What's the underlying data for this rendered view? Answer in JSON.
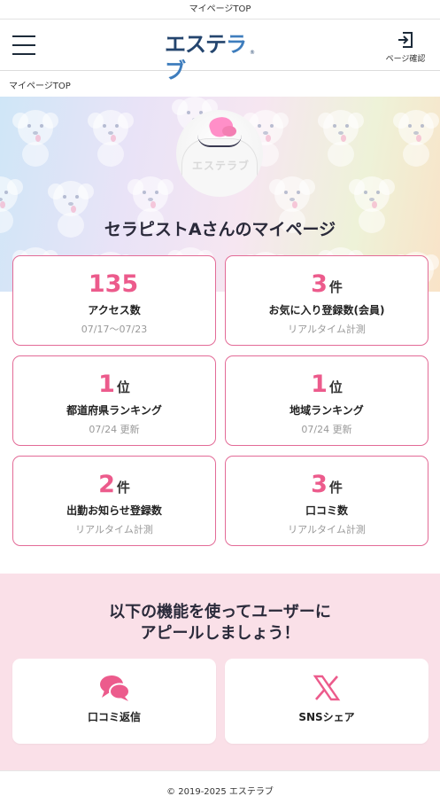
{
  "top_bar": {
    "title": "マイページTOP"
  },
  "header": {
    "logo": "エステラブ",
    "logo_reg": "®",
    "page_confirm_label": "ページ確認"
  },
  "breadcrumb": "マイページTOP",
  "hero": {
    "title": "セラピストAさんのマイページ",
    "avatar_watermark": "エステラブ"
  },
  "stats": [
    {
      "value": "135",
      "unit": "",
      "title": "アクセス数",
      "sub": "07/17〜07/23"
    },
    {
      "value": "3",
      "unit": "件",
      "title": "お気に入り登録数(会員)",
      "sub": "リアルタイム計測"
    },
    {
      "value": "1",
      "unit": "位",
      "title": "都道府県ランキング",
      "sub": "07/24 更新"
    },
    {
      "value": "1",
      "unit": "位",
      "title": "地域ランキング",
      "sub": "07/24 更新"
    },
    {
      "value": "2",
      "unit": "件",
      "title": "出勤お知らせ登録数",
      "sub": "リアルタイム計測"
    },
    {
      "value": "3",
      "unit": "件",
      "title": "口コミ数",
      "sub": "リアルタイム計測"
    }
  ],
  "promo": {
    "line1": "以下の機能を使ってユーザーに",
    "line2": "アピールしましょう！",
    "features": [
      {
        "label": "口コミ返信",
        "icon": "chat-bubbles-icon"
      },
      {
        "label": "SNSシェア",
        "icon": "x-logo-icon"
      }
    ]
  },
  "colors": {
    "accent_pink": "#ec5b8c",
    "card_border": "#e36b97",
    "logo_navy": "#24456e",
    "logo_blue": "#3e7dbd",
    "promo_bg": "#fae0e8"
  },
  "footer": {
    "copyright": "© 2019-2025 エステラブ"
  }
}
